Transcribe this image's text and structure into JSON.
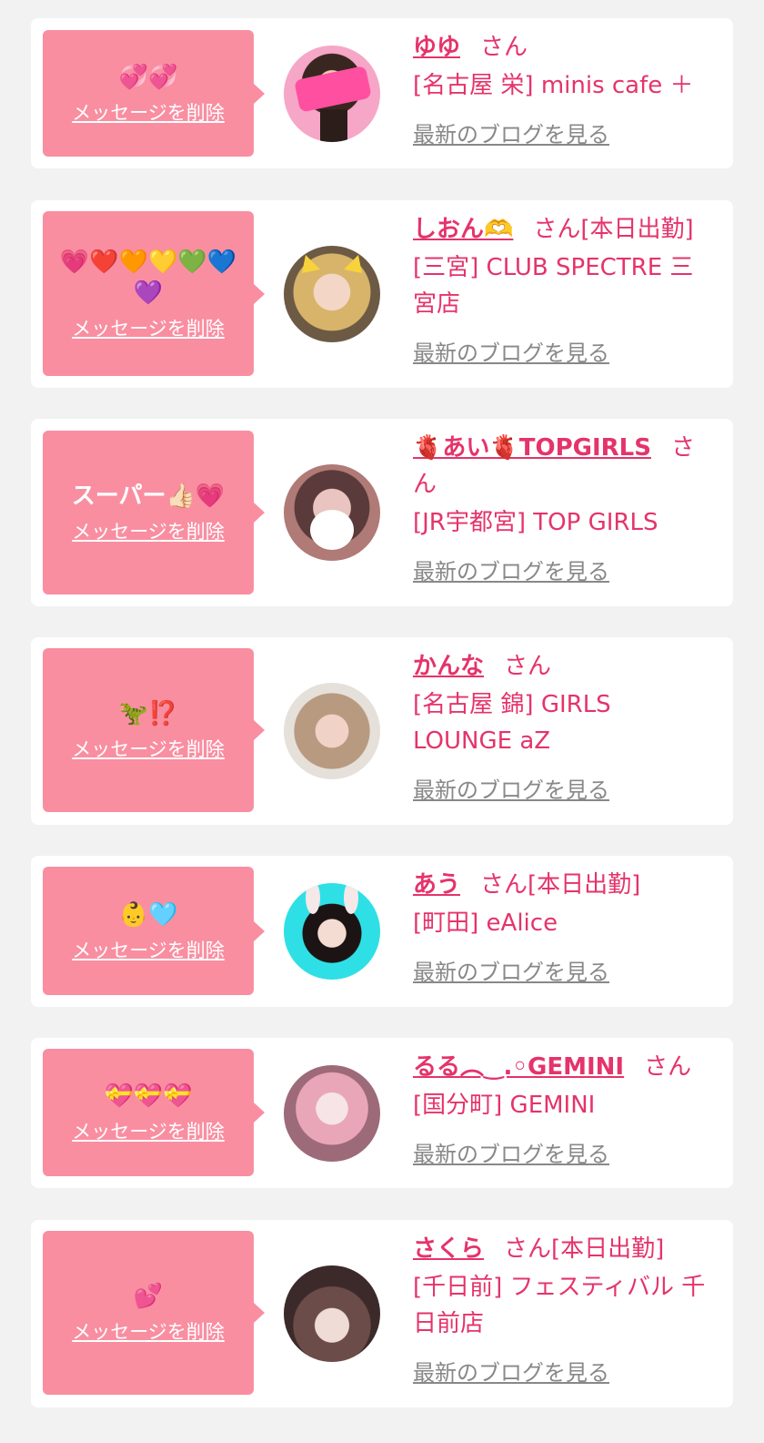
{
  "delete_label": "メッセージを削除",
  "blog_label": "最新のブログを見る",
  "san": "さん",
  "colors": {
    "accent": "#e5336b",
    "bubble": "#f98ea1",
    "background": "#f2f2f2",
    "link_gray": "#888888"
  },
  "cards": [
    {
      "message": "💞💞",
      "name": "ゆゆ",
      "status": "",
      "shop": "[名古屋 栄] minis cafe ＋"
    },
    {
      "message": "💗❤️🧡💛💚💙💜",
      "name": "しおん🫶",
      "status": "[本日出勤]",
      "shop": "[三宮] CLUB SPECTRE 三宮店"
    },
    {
      "message": "スーパー👍🏻💗",
      "name": "🫀あい🫀TOPGIRLS",
      "status": "",
      "shop": "[JR宇都宮] TOP GIRLS"
    },
    {
      "message": "🦖⁉️",
      "name": "かんな",
      "status": "",
      "shop": "[名古屋 錦] GIRLS LOUNGE aZ"
    },
    {
      "message": "👶🩵",
      "name": "あう",
      "status": "[本日出勤]",
      "shop": "[町田] eAlice"
    },
    {
      "message": "💝💝💝",
      "name": "るる︵‿.◦GEMINI",
      "status": "",
      "shop": "[国分町] GEMINI"
    },
    {
      "message": "💕",
      "name": "さくら",
      "status": "[本日出勤]",
      "shop": "[千日前] フェスティバル 千日前店"
    }
  ]
}
